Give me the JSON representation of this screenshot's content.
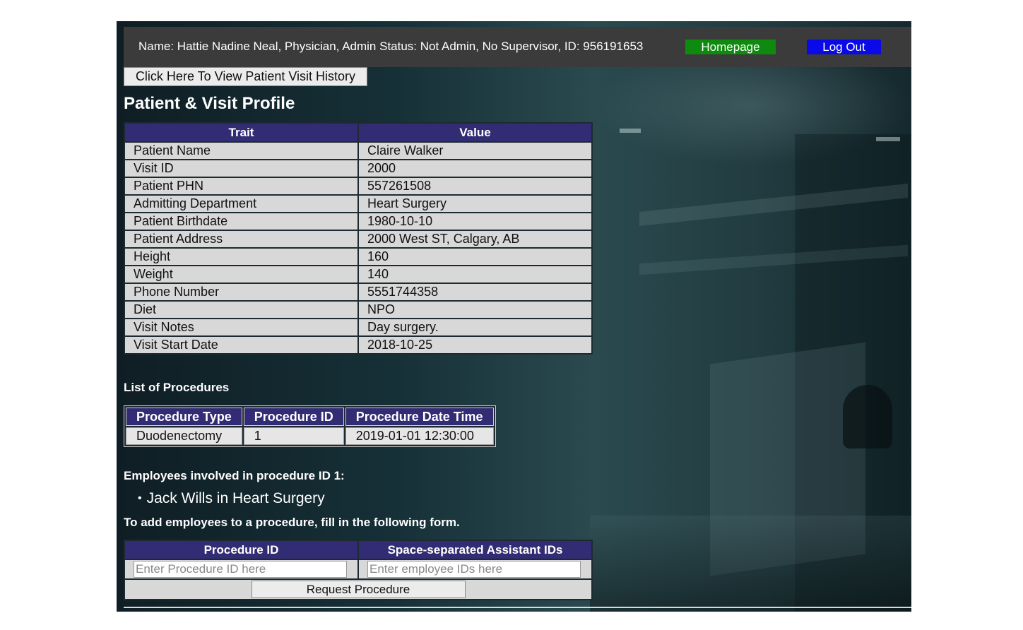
{
  "header": {
    "user_info": "Name: Hattie Nadine Neal, Physician, Admin Status: Not Admin, No Supervisor, ID: 956191653",
    "homepage_label": "Homepage",
    "logout_label": "Log Out",
    "homepage_color": "#0e8a0e",
    "logout_color": "#0a0ae8"
  },
  "history_button": "Click Here To View Patient Visit History",
  "profile": {
    "title": "Patient & Visit Profile",
    "columns": [
      "Trait",
      "Value"
    ],
    "rows": [
      [
        "Patient Name",
        "Claire Walker"
      ],
      [
        "Visit ID",
        "2000"
      ],
      [
        "Patient PHN",
        "557261508"
      ],
      [
        "Admitting Department",
        "Heart Surgery"
      ],
      [
        "Patient Birthdate",
        "1980-10-10"
      ],
      [
        "Patient Address",
        "2000 West ST, Calgary, AB"
      ],
      [
        "Height",
        "160"
      ],
      [
        "Weight",
        "140"
      ],
      [
        "Phone Number",
        "5551744358"
      ],
      [
        "Diet",
        "NPO"
      ],
      [
        "Visit Notes",
        "Day surgery."
      ],
      [
        "Visit Start Date",
        "2018-10-25"
      ]
    ]
  },
  "procedures": {
    "title": "List of Procedures",
    "columns": [
      "Procedure Type",
      "Procedure ID",
      "Procedure Date Time"
    ],
    "rows": [
      [
        "Duodenectomy",
        "1",
        "2019-01-01 12:30:00"
      ]
    ]
  },
  "employees": {
    "title": "Employees involved in procedure ID 1:",
    "items": [
      "Jack Wills in Heart Surgery"
    ]
  },
  "add_form": {
    "instructions": "To add employees to a procedure, fill in the following form.",
    "columns": [
      "Procedure ID",
      "Space-separated Assistant IDs"
    ],
    "procedure_id_placeholder": "Enter Procedure ID here",
    "employee_ids_placeholder": "Enter employee IDs here",
    "submit_label": "Request Procedure"
  }
}
